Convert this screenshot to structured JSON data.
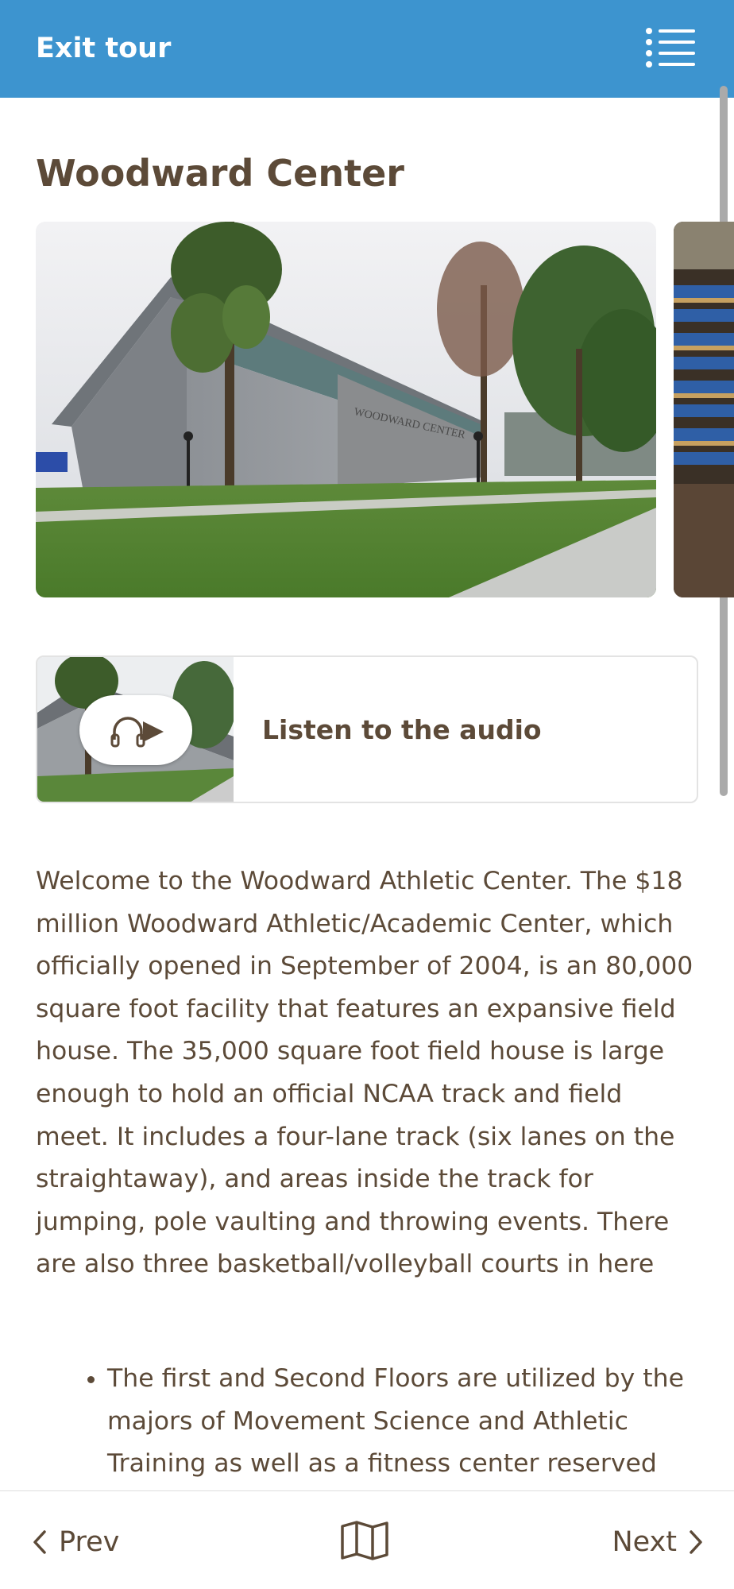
{
  "header": {
    "exit_label": "Exit tour",
    "menu_icon": "list-menu-icon",
    "background_color": "#3d94cf"
  },
  "stop": {
    "title": "Woodward Center"
  },
  "gallery": {
    "images": [
      {
        "name": "woodward-center-exterior-photo",
        "sign_text": "WOODWARD CENTER"
      },
      {
        "name": "field-house-bleachers-photo"
      }
    ]
  },
  "audio": {
    "label": "Listen to the audio",
    "icon": "headphones-play-icon"
  },
  "description": {
    "paragraph": "Welcome to the Woodward Athletic Center. The $18 million Woodward Athletic/Academic Center, which officially opened in September of 2004, is an 80,000 square foot facility that features an expansive field house. The 35,000 square foot field house is large enough to hold an official NCAA track and field meet. It includes a four-lane track (six lanes on the straightaway), and areas inside the track for jumping, pole vaulting and throwing events. There are also three basketball/volleyball courts in here",
    "bullets": [
      "The first and Second Floors are utilized by the majors of Movement Science and Athletic Training as well as a fitness center reserved"
    ]
  },
  "footer": {
    "prev_label": "Prev",
    "next_label": "Next",
    "map_icon": "map-icon"
  },
  "colors": {
    "text": "#5c4a38",
    "accent": "#3d94cf"
  }
}
